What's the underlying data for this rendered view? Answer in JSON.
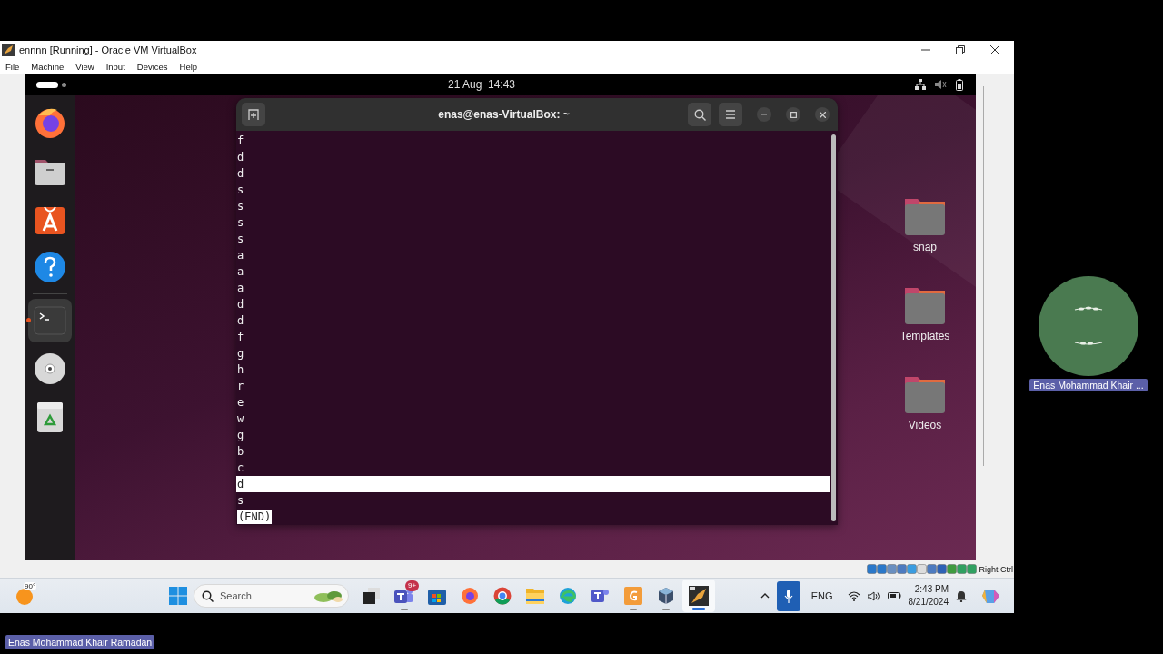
{
  "vbox": {
    "title": "ennnn [Running] - Oracle VM VirtualBox",
    "menu": [
      "File",
      "Machine",
      "View",
      "Input",
      "Devices",
      "Help"
    ],
    "host_key": "Right Ctrl"
  },
  "ubuntu": {
    "clock": "21 Aug  14:43",
    "dock": [
      {
        "selected": false
      },
      {
        "selected": false
      },
      {
        "selected": false
      },
      {
        "selected": false
      },
      {
        "selected": true
      },
      {
        "selected": false
      },
      {
        "selected": false
      }
    ],
    "desktop_icons": [
      {
        "label": "snap"
      },
      {
        "label": "Templates"
      },
      {
        "label": "Videos"
      }
    ]
  },
  "terminal": {
    "title": "enas@enas-VirtualBox: ~",
    "lines": [
      {
        "text": "f",
        "highlighted": false
      },
      {
        "text": "d",
        "highlighted": false
      },
      {
        "text": "d",
        "highlighted": false
      },
      {
        "text": "s",
        "highlighted": false
      },
      {
        "text": "s",
        "highlighted": false
      },
      {
        "text": "s",
        "highlighted": false
      },
      {
        "text": "s",
        "highlighted": false
      },
      {
        "text": "a",
        "highlighted": false
      },
      {
        "text": "a",
        "highlighted": false
      },
      {
        "text": "a",
        "highlighted": false
      },
      {
        "text": "d",
        "highlighted": false
      },
      {
        "text": "d",
        "highlighted": false
      },
      {
        "text": "f",
        "highlighted": false
      },
      {
        "text": "g",
        "highlighted": false
      },
      {
        "text": "h",
        "highlighted": false
      },
      {
        "text": "r",
        "highlighted": false
      },
      {
        "text": "e",
        "highlighted": false
      },
      {
        "text": "w",
        "highlighted": false
      },
      {
        "text": "g",
        "highlighted": false
      },
      {
        "text": "b",
        "highlighted": false
      },
      {
        "text": "c",
        "highlighted": false
      },
      {
        "text": "d",
        "highlighted": true
      },
      {
        "text": "s",
        "highlighted": false
      }
    ],
    "end_marker": "(END)"
  },
  "taskbar": {
    "weather": "90°",
    "search": {
      "placeholder": "Search"
    },
    "apps": [
      {
        "selected": false,
        "running": false
      },
      {
        "selected": false,
        "running": true,
        "badge": "9+"
      },
      {
        "selected": false,
        "running": false
      },
      {
        "selected": false,
        "running": false
      },
      {
        "selected": false,
        "running": false
      },
      {
        "selected": false,
        "running": false
      },
      {
        "selected": false,
        "running": false
      },
      {
        "selected": false,
        "running": false
      },
      {
        "selected": false,
        "running": true
      },
      {
        "selected": false,
        "running": true
      },
      {
        "selected": true,
        "running": true
      }
    ],
    "language": "ENG",
    "time": "2:43 PM",
    "date": "8/21/2024"
  },
  "meeting": {
    "tile_name": "Enas Mohammad Khair ...",
    "speaker_name": "Enas Mohammad Khair Ramadan"
  }
}
